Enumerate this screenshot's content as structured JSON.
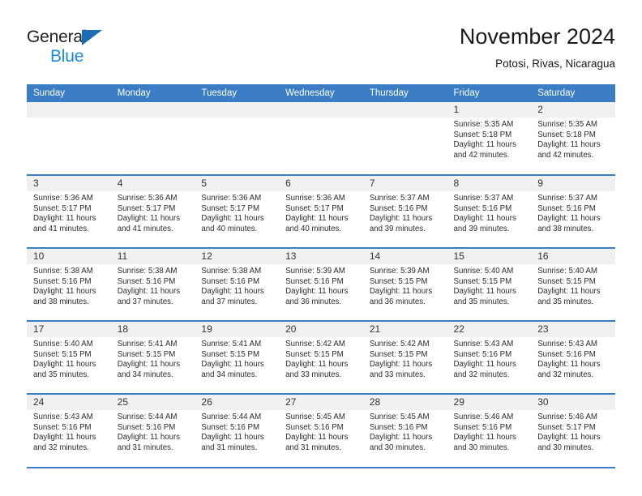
{
  "brand": {
    "name_part1": "General",
    "name_part2": "Blue",
    "triangle_icon": "triangle-icon"
  },
  "header": {
    "title": "November 2024",
    "subtitle": "Potosi, Rivas, Nicaragua"
  },
  "colors": {
    "header_blue": "#3b7dc4",
    "brand_blue": "#1a8ae0",
    "logo_triangle": "#1a6cb5",
    "daynum_band": "#f0f0f0"
  },
  "weekdays": [
    "Sunday",
    "Monday",
    "Tuesday",
    "Wednesday",
    "Thursday",
    "Friday",
    "Saturday"
  ],
  "weeks": [
    [
      {
        "day": "",
        "empty": true,
        "sunrise": "",
        "sunset": "",
        "daylight_line1": "",
        "daylight_line2": ""
      },
      {
        "day": "",
        "empty": true,
        "sunrise": "",
        "sunset": "",
        "daylight_line1": "",
        "daylight_line2": ""
      },
      {
        "day": "",
        "empty": true,
        "sunrise": "",
        "sunset": "",
        "daylight_line1": "",
        "daylight_line2": ""
      },
      {
        "day": "",
        "empty": true,
        "sunrise": "",
        "sunset": "",
        "daylight_line1": "",
        "daylight_line2": ""
      },
      {
        "day": "",
        "empty": true,
        "sunrise": "",
        "sunset": "",
        "daylight_line1": "",
        "daylight_line2": ""
      },
      {
        "day": "1",
        "empty": false,
        "sunrise": "Sunrise: 5:35 AM",
        "sunset": "Sunset: 5:18 PM",
        "daylight_line1": "Daylight: 11 hours",
        "daylight_line2": "and 42 minutes."
      },
      {
        "day": "2",
        "empty": false,
        "sunrise": "Sunrise: 5:35 AM",
        "sunset": "Sunset: 5:18 PM",
        "daylight_line1": "Daylight: 11 hours",
        "daylight_line2": "and 42 minutes."
      }
    ],
    [
      {
        "day": "3",
        "empty": false,
        "sunrise": "Sunrise: 5:36 AM",
        "sunset": "Sunset: 5:17 PM",
        "daylight_line1": "Daylight: 11 hours",
        "daylight_line2": "and 41 minutes."
      },
      {
        "day": "4",
        "empty": false,
        "sunrise": "Sunrise: 5:36 AM",
        "sunset": "Sunset: 5:17 PM",
        "daylight_line1": "Daylight: 11 hours",
        "daylight_line2": "and 41 minutes."
      },
      {
        "day": "5",
        "empty": false,
        "sunrise": "Sunrise: 5:36 AM",
        "sunset": "Sunset: 5:17 PM",
        "daylight_line1": "Daylight: 11 hours",
        "daylight_line2": "and 40 minutes."
      },
      {
        "day": "6",
        "empty": false,
        "sunrise": "Sunrise: 5:36 AM",
        "sunset": "Sunset: 5:17 PM",
        "daylight_line1": "Daylight: 11 hours",
        "daylight_line2": "and 40 minutes."
      },
      {
        "day": "7",
        "empty": false,
        "sunrise": "Sunrise: 5:37 AM",
        "sunset": "Sunset: 5:16 PM",
        "daylight_line1": "Daylight: 11 hours",
        "daylight_line2": "and 39 minutes."
      },
      {
        "day": "8",
        "empty": false,
        "sunrise": "Sunrise: 5:37 AM",
        "sunset": "Sunset: 5:16 PM",
        "daylight_line1": "Daylight: 11 hours",
        "daylight_line2": "and 39 minutes."
      },
      {
        "day": "9",
        "empty": false,
        "sunrise": "Sunrise: 5:37 AM",
        "sunset": "Sunset: 5:16 PM",
        "daylight_line1": "Daylight: 11 hours",
        "daylight_line2": "and 38 minutes."
      }
    ],
    [
      {
        "day": "10",
        "empty": false,
        "sunrise": "Sunrise: 5:38 AM",
        "sunset": "Sunset: 5:16 PM",
        "daylight_line1": "Daylight: 11 hours",
        "daylight_line2": "and 38 minutes."
      },
      {
        "day": "11",
        "empty": false,
        "sunrise": "Sunrise: 5:38 AM",
        "sunset": "Sunset: 5:16 PM",
        "daylight_line1": "Daylight: 11 hours",
        "daylight_line2": "and 37 minutes."
      },
      {
        "day": "12",
        "empty": false,
        "sunrise": "Sunrise: 5:38 AM",
        "sunset": "Sunset: 5:16 PM",
        "daylight_line1": "Daylight: 11 hours",
        "daylight_line2": "and 37 minutes."
      },
      {
        "day": "13",
        "empty": false,
        "sunrise": "Sunrise: 5:39 AM",
        "sunset": "Sunset: 5:16 PM",
        "daylight_line1": "Daylight: 11 hours",
        "daylight_line2": "and 36 minutes."
      },
      {
        "day": "14",
        "empty": false,
        "sunrise": "Sunrise: 5:39 AM",
        "sunset": "Sunset: 5:15 PM",
        "daylight_line1": "Daylight: 11 hours",
        "daylight_line2": "and 36 minutes."
      },
      {
        "day": "15",
        "empty": false,
        "sunrise": "Sunrise: 5:40 AM",
        "sunset": "Sunset: 5:15 PM",
        "daylight_line1": "Daylight: 11 hours",
        "daylight_line2": "and 35 minutes."
      },
      {
        "day": "16",
        "empty": false,
        "sunrise": "Sunrise: 5:40 AM",
        "sunset": "Sunset: 5:15 PM",
        "daylight_line1": "Daylight: 11 hours",
        "daylight_line2": "and 35 minutes."
      }
    ],
    [
      {
        "day": "17",
        "empty": false,
        "sunrise": "Sunrise: 5:40 AM",
        "sunset": "Sunset: 5:15 PM",
        "daylight_line1": "Daylight: 11 hours",
        "daylight_line2": "and 35 minutes."
      },
      {
        "day": "18",
        "empty": false,
        "sunrise": "Sunrise: 5:41 AM",
        "sunset": "Sunset: 5:15 PM",
        "daylight_line1": "Daylight: 11 hours",
        "daylight_line2": "and 34 minutes."
      },
      {
        "day": "19",
        "empty": false,
        "sunrise": "Sunrise: 5:41 AM",
        "sunset": "Sunset: 5:15 PM",
        "daylight_line1": "Daylight: 11 hours",
        "daylight_line2": "and 34 minutes."
      },
      {
        "day": "20",
        "empty": false,
        "sunrise": "Sunrise: 5:42 AM",
        "sunset": "Sunset: 5:15 PM",
        "daylight_line1": "Daylight: 11 hours",
        "daylight_line2": "and 33 minutes."
      },
      {
        "day": "21",
        "empty": false,
        "sunrise": "Sunrise: 5:42 AM",
        "sunset": "Sunset: 5:15 PM",
        "daylight_line1": "Daylight: 11 hours",
        "daylight_line2": "and 33 minutes."
      },
      {
        "day": "22",
        "empty": false,
        "sunrise": "Sunrise: 5:43 AM",
        "sunset": "Sunset: 5:16 PM",
        "daylight_line1": "Daylight: 11 hours",
        "daylight_line2": "and 32 minutes."
      },
      {
        "day": "23",
        "empty": false,
        "sunrise": "Sunrise: 5:43 AM",
        "sunset": "Sunset: 5:16 PM",
        "daylight_line1": "Daylight: 11 hours",
        "daylight_line2": "and 32 minutes."
      }
    ],
    [
      {
        "day": "24",
        "empty": false,
        "sunrise": "Sunrise: 5:43 AM",
        "sunset": "Sunset: 5:16 PM",
        "daylight_line1": "Daylight: 11 hours",
        "daylight_line2": "and 32 minutes."
      },
      {
        "day": "25",
        "empty": false,
        "sunrise": "Sunrise: 5:44 AM",
        "sunset": "Sunset: 5:16 PM",
        "daylight_line1": "Daylight: 11 hours",
        "daylight_line2": "and 31 minutes."
      },
      {
        "day": "26",
        "empty": false,
        "sunrise": "Sunrise: 5:44 AM",
        "sunset": "Sunset: 5:16 PM",
        "daylight_line1": "Daylight: 11 hours",
        "daylight_line2": "and 31 minutes."
      },
      {
        "day": "27",
        "empty": false,
        "sunrise": "Sunrise: 5:45 AM",
        "sunset": "Sunset: 5:16 PM",
        "daylight_line1": "Daylight: 11 hours",
        "daylight_line2": "and 31 minutes."
      },
      {
        "day": "28",
        "empty": false,
        "sunrise": "Sunrise: 5:45 AM",
        "sunset": "Sunset: 5:16 PM",
        "daylight_line1": "Daylight: 11 hours",
        "daylight_line2": "and 30 minutes."
      },
      {
        "day": "29",
        "empty": false,
        "sunrise": "Sunrise: 5:46 AM",
        "sunset": "Sunset: 5:16 PM",
        "daylight_line1": "Daylight: 11 hours",
        "daylight_line2": "and 30 minutes."
      },
      {
        "day": "30",
        "empty": false,
        "sunrise": "Sunrise: 5:46 AM",
        "sunset": "Sunset: 5:17 PM",
        "daylight_line1": "Daylight: 11 hours",
        "daylight_line2": "and 30 minutes."
      }
    ]
  ]
}
